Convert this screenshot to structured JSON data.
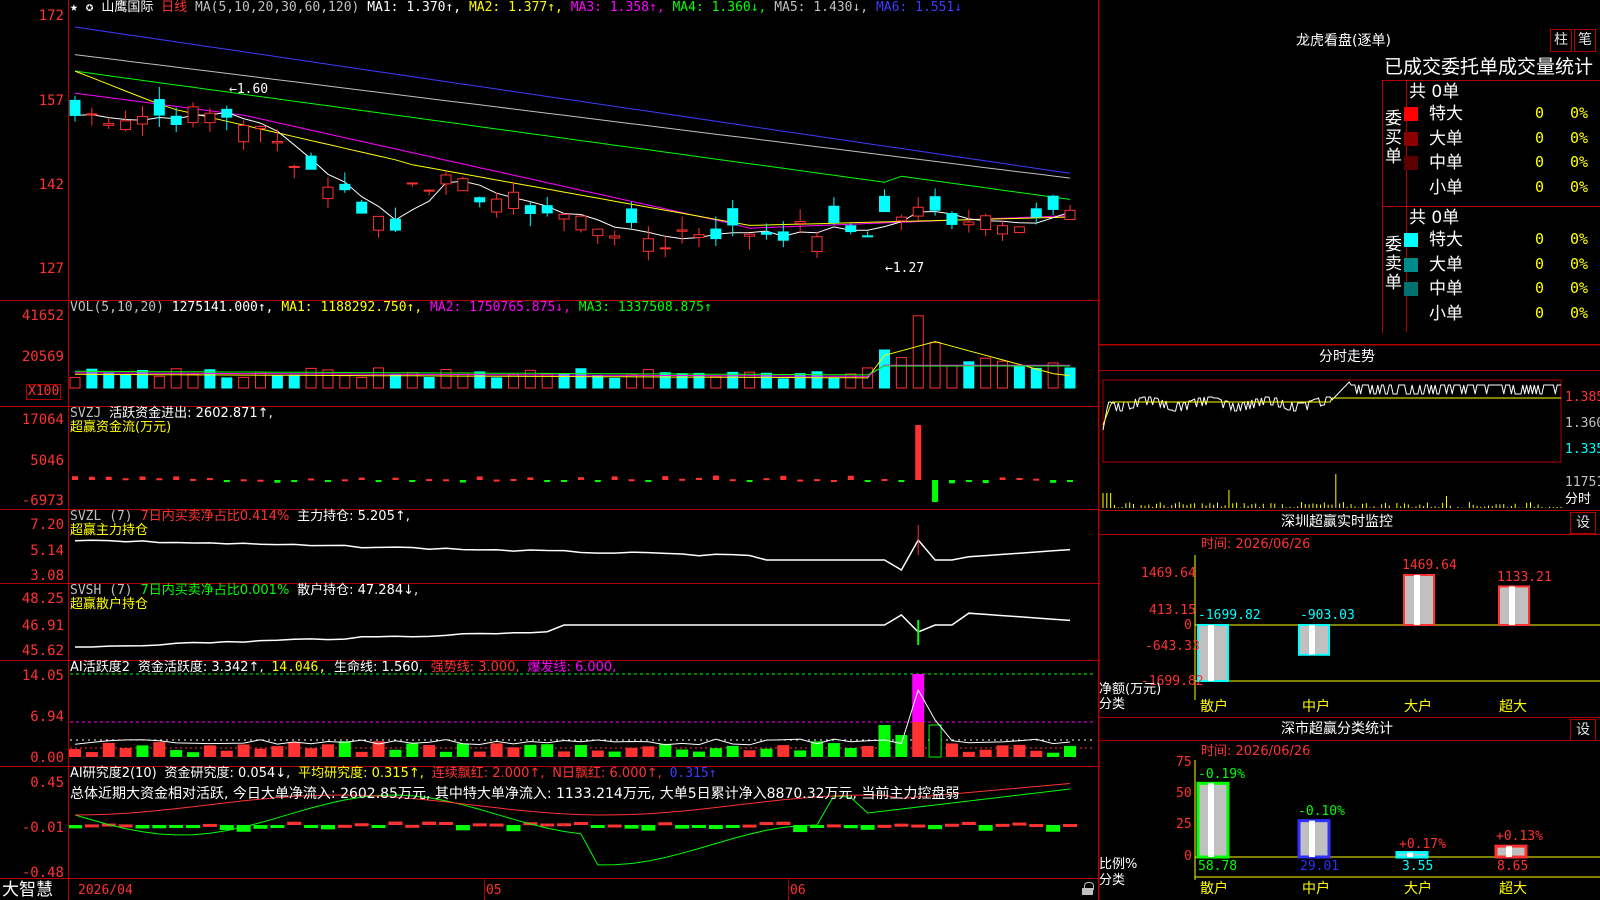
{
  "stock": {
    "star_marks": "★ ✪",
    "name": "山鹰国际",
    "period": "日线",
    "ma_params": "MA(5,10,20,30,60,120)",
    "ma1": "MA1: 1.370↑,",
    "ma2": "MA2: 1.377↑,",
    "ma3": "MA3: 1.358↑,",
    "ma4": "MA4: 1.360↓,",
    "ma5": "MA5: 1.430↓,",
    "ma6": "MA6: 1.551↓",
    "high_marker": "←1.60",
    "low_marker": "←1.27"
  },
  "main_axis": [
    "172",
    "157",
    "142",
    "127"
  ],
  "vol": {
    "label": "VOL(5,10,20)",
    "value": "1275141.000↑,",
    "ma1": "MA1: 1188292.750↑,",
    "ma2": "MA2: 1750765.875↓,",
    "ma3": "MA3: 1337508.875↑",
    "axis": [
      "41652",
      "20569"
    ],
    "unit": "X100"
  },
  "svzj": {
    "label": "SVZJ",
    "title": "活跃资金进出: 2602.871↑,",
    "sub": "超赢资金流(万元)",
    "axis": [
      "17064",
      "5046",
      "-6973"
    ]
  },
  "svzl": {
    "label": "SVZL (7)",
    "ratio": "7日内买卖净占比0.414%",
    "holding": "主力持仓: 5.205↑,",
    "sub": "超赢主力持仓",
    "axis": [
      "7.20",
      "5.14",
      "3.08"
    ]
  },
  "svsh": {
    "label": "SVSH (7)",
    "ratio": "7日内买卖净占比0.001%",
    "holding": "散户持仓: 47.284↓,",
    "sub": "超赢散户持仓",
    "axis": [
      "48.25",
      "46.91",
      "45.62"
    ]
  },
  "ai_active": {
    "label": "AI活跃度2",
    "v1": "资金活跃度: 3.342↑,",
    "v2": "14.046,",
    "v3": "生命线: 1.560,",
    "v4": "强势线: 3.000,",
    "v5": "爆发线: 6.000,",
    "axis": [
      "14.05",
      "6.94",
      "0.00"
    ]
  },
  "ai_research": {
    "label": "AI研究度2(10)",
    "v1": "资金研究度: 0.054↓,",
    "v2": "平均研究度: 0.315↑,",
    "v3": "连续飘红: 2.000↑,",
    "v4": "N日飘红: 6.000↑,",
    "v5": "0.315↑",
    "summary": "总体近期大资金相对活跃, 今日大单净流入: 2602.85万元, 其中特大单净流入: 1133.214万元, 大单5日累计净入8870.32万元, 当前主力控盘弱",
    "axis": [
      "0.45",
      "-0.01",
      "-0.48"
    ]
  },
  "bottom_axis": {
    "brand": "大智慧",
    "date": "2026/04",
    "m05": "05",
    "m06": "06"
  },
  "longhu": {
    "title": "龙虎看盘(逐单)",
    "btn1": "柱",
    "btn2": "笔",
    "header": "已成交委托单成交量统计",
    "buy_label": "委买单",
    "sell_label": "委卖单",
    "buy_total": "共 0单",
    "sell_total": "共 0单",
    "buy_rows": [
      {
        "name": "特大",
        "qty": "0",
        "pct": "0%",
        "color": "#ff0000"
      },
      {
        "name": "大单",
        "qty": "0",
        "pct": "0%",
        "color": "#8a0000"
      },
      {
        "name": "中单",
        "qty": "0",
        "pct": "0%",
        "color": "#5a0000"
      },
      {
        "name": "小单",
        "qty": "0",
        "pct": "0%",
        "color": ""
      }
    ],
    "sell_rows": [
      {
        "name": "特大",
        "qty": "0",
        "pct": "0%",
        "color": "#00ffff"
      },
      {
        "name": "大单",
        "qty": "0",
        "pct": "0%",
        "color": "#008a8a"
      },
      {
        "name": "中单",
        "qty": "0",
        "pct": "0%",
        "color": "#007070"
      },
      {
        "name": "小单",
        "qty": "0",
        "pct": "0%",
        "color": ""
      }
    ]
  },
  "intraday": {
    "title": "分时走势",
    "axis": [
      "1.385",
      "1.360",
      "1.335"
    ],
    "vol_label": "11751",
    "footer": "分时"
  },
  "sz_monitor": {
    "title": "深圳超赢实时监控",
    "btn": "设",
    "time": "时间: 2026/06/26",
    "axis": [
      "1469.64",
      "413.15",
      "0",
      "-643.33",
      "-1699.82"
    ],
    "ylabel1": "净额(万元)",
    "ylabel2": "分类",
    "bars": [
      {
        "label": "散户",
        "value": -1699.82,
        "text": "-1699.82"
      },
      {
        "label": "中户",
        "value": -903.03,
        "text": "-903.03"
      },
      {
        "label": "大户",
        "value": 1469.64,
        "text": "1469.64"
      },
      {
        "label": "超大",
        "value": 1133.21,
        "text": "1133.21"
      }
    ]
  },
  "sz_classify": {
    "title": "深市超赢分类统计",
    "btn": "设",
    "time": "时间: 2026/06/26",
    "axis": [
      "75",
      "50",
      "25",
      "0"
    ],
    "ylabel1": "比例%",
    "ylabel2": "分类",
    "bars": [
      {
        "label": "散户",
        "value": 58.78,
        "text": "58.78",
        "delta": "-0.19%",
        "color": "#00ff00"
      },
      {
        "label": "中户",
        "value": 29.01,
        "text": "29.01",
        "delta": "-0.10%",
        "color": "#3030ff"
      },
      {
        "label": "大户",
        "value": 3.55,
        "text": "3.55",
        "delta": "+0.17%",
        "color": "#00ffff"
      },
      {
        "label": "超大",
        "value": 8.65,
        "text": "8.65",
        "delta": "+0.13%",
        "color": "#ff3232"
      }
    ]
  },
  "colors": {
    "up": "#ff3232",
    "down": "#00ffff",
    "ma1": "#ffffff",
    "ma2": "#ffff00",
    "ma3": "#ff00ff",
    "ma4": "#00ff00",
    "ma5": "#c0c0c0",
    "ma6": "#3c3cff",
    "grid": "#b00000"
  }
}
